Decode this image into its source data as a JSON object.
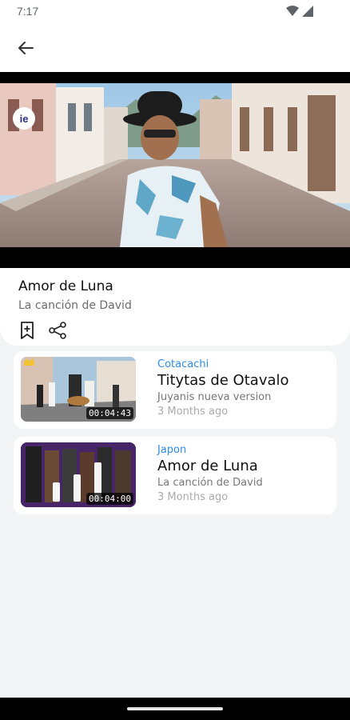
{
  "status": {
    "time": "7:17"
  },
  "now_playing": {
    "channel_logo": "ie",
    "title": "Amor de Luna",
    "subtitle": "La canción de David"
  },
  "icons": {
    "back": "arrow-left-icon",
    "bookmark": "bookmark-add-icon",
    "share": "share-icon",
    "wifi": "wifi-icon",
    "signal": "signal-icon"
  },
  "list": [
    {
      "category": "Cotacachi",
      "title": "Titytas de Otavalo",
      "subtitle": "Juyanis nueva version",
      "time": "3 Months ago",
      "duration": "00:04:43"
    },
    {
      "category": "Japon",
      "title": "Amor de Luna",
      "subtitle": "La canción de David",
      "time": "3 Months ago",
      "duration": "00:04:00"
    }
  ],
  "colors": {
    "accent": "#2f8be6",
    "background": "#f3f4f6",
    "card": "#ffffff"
  }
}
